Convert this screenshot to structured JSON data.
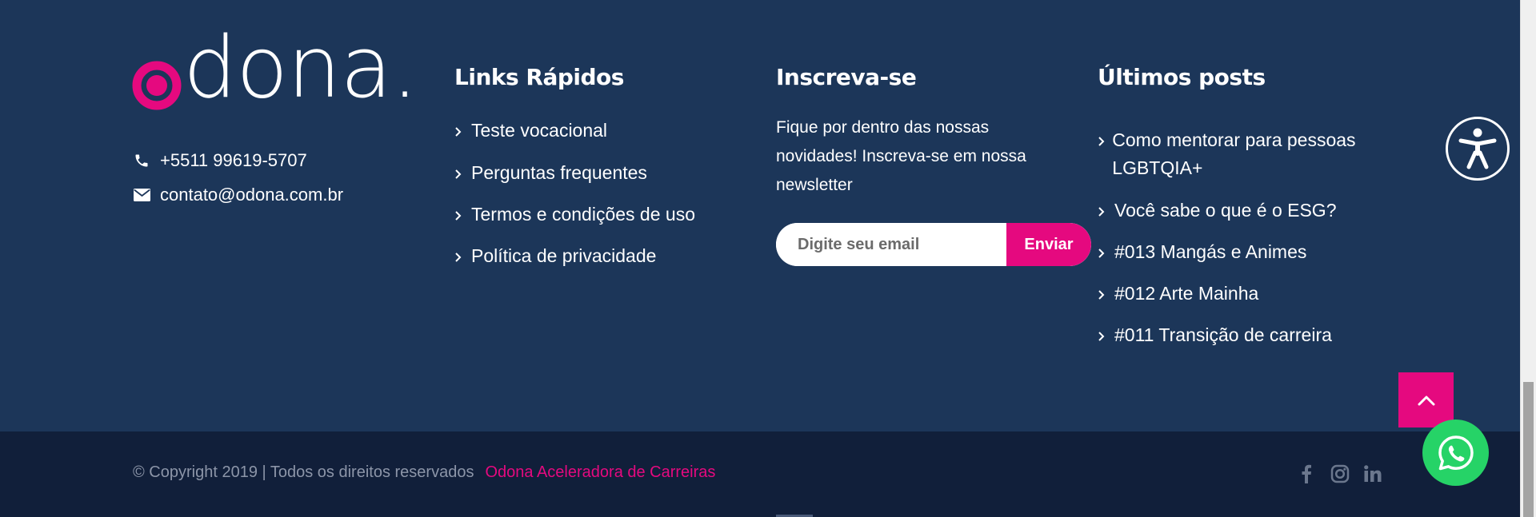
{
  "logo": {
    "text": "dona."
  },
  "contact": {
    "phone": "+5511 99619-5707",
    "email": "contato@odona.com.br"
  },
  "quick_links": {
    "title": "Links Rápidos",
    "items": [
      {
        "label": "Teste vocacional"
      },
      {
        "label": "Perguntas frequentes"
      },
      {
        "label": "Termos e condições de uso"
      },
      {
        "label": "Política de privacidade"
      }
    ]
  },
  "subscribe": {
    "title": "Inscreva-se",
    "description": "Fique por dentro das nossas novidades! Inscreva-se em nossa newsletter",
    "placeholder": "Digite seu email",
    "button": "Enviar"
  },
  "latest_posts": {
    "title": "Últimos posts",
    "items": [
      {
        "label": "Como mentorar para pessoas LGBTQIA+"
      },
      {
        "label": "Você sabe o que é o ESG?"
      },
      {
        "label": "#013 Mangás e Animes"
      },
      {
        "label": "#012 Arte Mainha"
      },
      {
        "label": "#011 Transição de carreira"
      }
    ]
  },
  "footer": {
    "copyright": "© Copyright 2019 | Todos os direitos reservados",
    "brand_link": "Odona Aceleradora de Carreiras"
  },
  "icons": {
    "phone": "phone-icon",
    "email": "envelope-icon",
    "accessibility": "accessibility-icon",
    "back_to_top": "chevron-up-icon",
    "whatsapp": "whatsapp-icon",
    "social": [
      "facebook-icon",
      "instagram-icon",
      "linkedin-icon"
    ]
  },
  "colors": {
    "footer_bg": "#1c3659",
    "bottom_bar_bg": "#111f3a",
    "accent": "#e5097f",
    "whatsapp": "#26d367"
  }
}
